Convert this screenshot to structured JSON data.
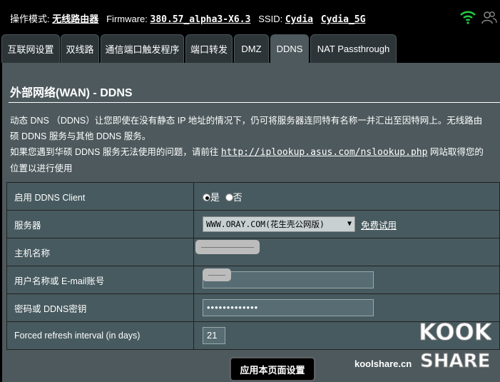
{
  "topbar": {
    "mode_label": "操作模式:",
    "mode_value": "无线路由器",
    "firmware_label": "Firmware:",
    "firmware_value": "380.57_alpha3-X6.3",
    "ssid_label": "SSID:",
    "ssid_1": "Cydia",
    "ssid_2": "Cydia_5G",
    "wifi_color": "#22cc44"
  },
  "tabs": [
    {
      "label": "互联网设置",
      "active": false
    },
    {
      "label": "双线路",
      "active": false
    },
    {
      "label": "通信端口触发程序",
      "active": false
    },
    {
      "label": "端口转发",
      "active": false
    },
    {
      "label": "DMZ",
      "active": false
    },
    {
      "label": "DDNS",
      "active": true
    },
    {
      "label": "NAT Passthrough",
      "active": false
    }
  ],
  "page": {
    "title": "外部网络(WAN) - DDNS",
    "desc_line1": "动态 DNS （DDNS）让您即使在没有静态 IP 地址的情况下，仍可将服务器连同特有名称一并汇出至因特网上。无线路由",
    "desc_line2": "硕 DDNS 服务与其他 DDNS 服务。",
    "desc_line3_pre": "如果您遇到华硕 DDNS 服务无法使用的问题，请前往 ",
    "desc_link": "http://iplookup.asus.com/nslookup.php",
    "desc_line3_post": " 网站取得您的",
    "desc_line4": "位置以进行使用"
  },
  "form": {
    "enable_label": "启用 DDNS Client",
    "enable_yes": "是",
    "enable_no": "否",
    "server_label": "服务器",
    "server_value": "WWW.ORAY.COM(花生壳公网版)",
    "server_link": "免费试用",
    "host_label": "主机名称",
    "user_label": "用户名称或 E-mail账号",
    "password_label": "密码或 DDNS密钥",
    "password_value": "•••••••••••••",
    "refresh_label": "Forced refresh interval (in days)",
    "refresh_value": "21"
  },
  "apply_label": "应用本页面设置",
  "watermark": {
    "site": "koolshare.cn",
    "logo_top": "KOOK",
    "logo_bottom": "SHARE"
  }
}
